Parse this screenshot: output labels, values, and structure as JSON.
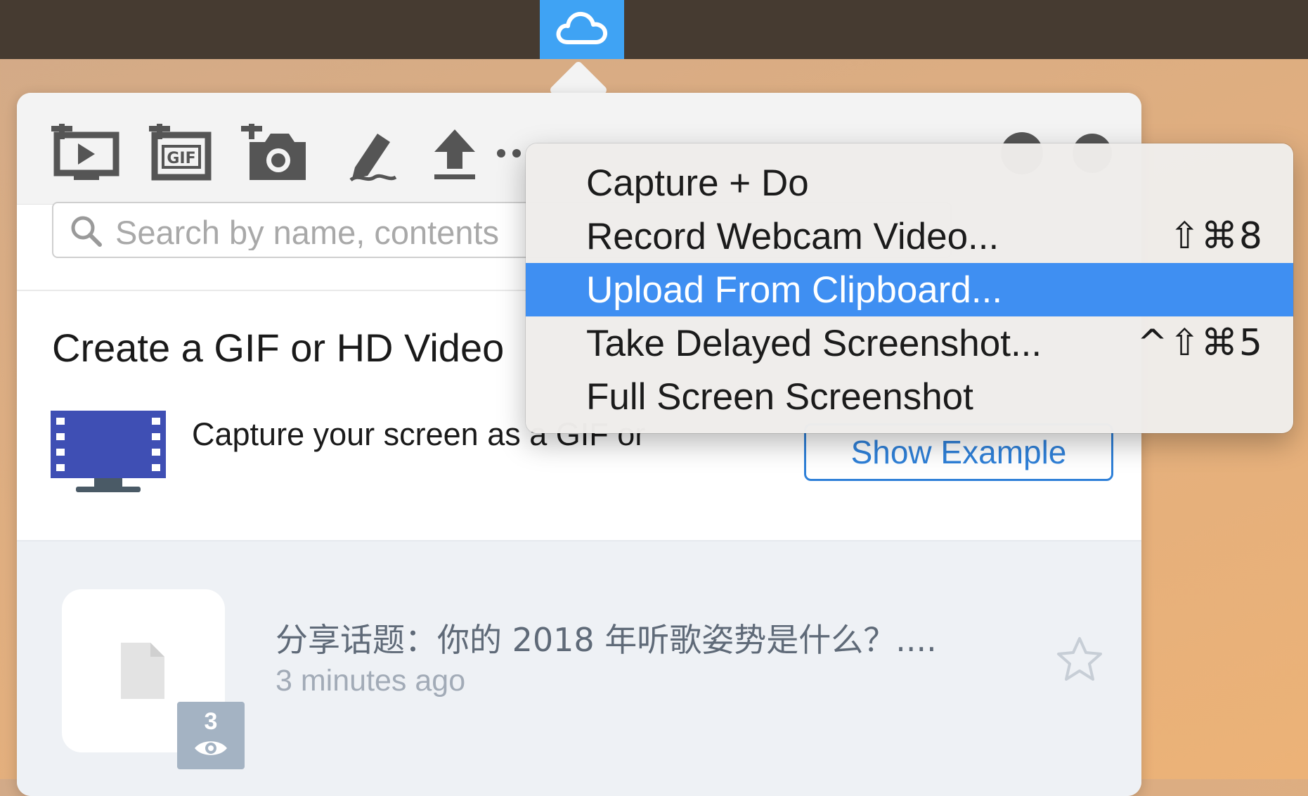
{
  "menubar": {
    "tray_icon": "cloud-icon"
  },
  "toolbar": {
    "tools": [
      {
        "name": "record-video-icon"
      },
      {
        "name": "record-gif-icon"
      },
      {
        "name": "screenshot-icon"
      },
      {
        "name": "annotate-icon"
      },
      {
        "name": "upload-icon"
      },
      {
        "name": "more-icon"
      },
      {
        "name": "globe-icon"
      },
      {
        "name": "gear-icon"
      }
    ]
  },
  "search": {
    "placeholder": "Search by name, contents"
  },
  "promo": {
    "title": "Create a GIF or HD Video",
    "description": "Capture your screen as a GIF or",
    "button_label": "Show Example"
  },
  "history": {
    "items": [
      {
        "title": "分享话题：你的 2018 年听歌姿势是什么？....",
        "time": "3 minutes ago",
        "views": "3"
      }
    ]
  },
  "menu": {
    "items": [
      {
        "label": "Capture + Do",
        "shortcut": "",
        "selected": false
      },
      {
        "label": "Record Webcam Video...",
        "shortcut": "⇧⌘8",
        "selected": false
      },
      {
        "label": "Upload From Clipboard...",
        "shortcut": "",
        "selected": true
      },
      {
        "label": "Take Delayed Screenshot...",
        "shortcut": "^⇧⌘5",
        "selected": false
      },
      {
        "label": "Full Screen Screenshot",
        "shortcut": "",
        "selected": false
      }
    ]
  },
  "colors": {
    "accent": "#3f8ff2",
    "menubar": "#463b31",
    "promo_icon": "#3f4fb4"
  }
}
